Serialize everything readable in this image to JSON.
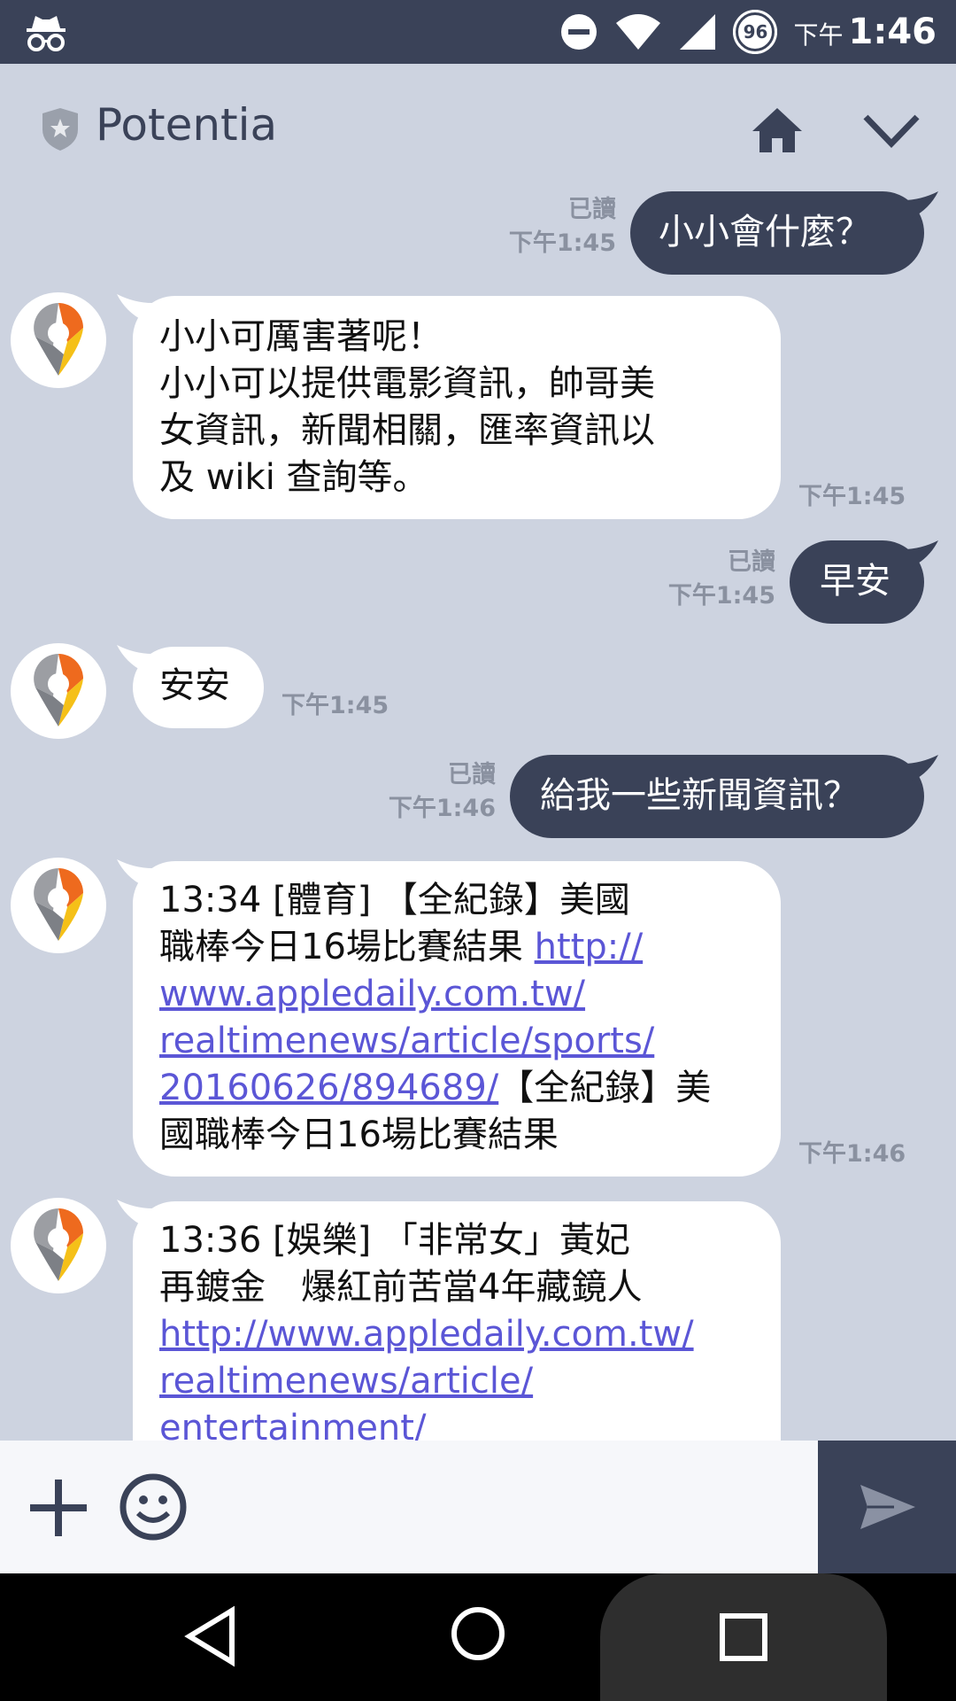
{
  "status_bar": {
    "battery_level": "96",
    "ampm": "下午",
    "time": "1:46"
  },
  "header": {
    "title": "Potentia"
  },
  "messages": [
    {
      "from": "me",
      "text": "小小會什麼？",
      "read": "已讀",
      "time": "下午1:45"
    },
    {
      "from": "bot",
      "lines": [
        "小小可厲害著呢！",
        "小小可以提供電影資訊，帥哥美",
        "女資訊，新聞相關，匯率資訊以",
        "及 wiki 查詢等。"
      ],
      "time": "下午1:45"
    },
    {
      "from": "me",
      "text": "早安",
      "read": "已讀",
      "time": "下午1:45"
    },
    {
      "from": "bot",
      "text": "安安",
      "time": "下午1:45"
    },
    {
      "from": "me",
      "text": "給我一些新聞資訊？",
      "read": "已讀",
      "time": "下午1:46"
    },
    {
      "from": "bot",
      "line1": "13:34  [體育] 【全紀錄】美國",
      "line2": "職棒今日16場比賽結果 ",
      "link_start": "http://",
      "link_lines": [
        "www.appledaily.com.tw/",
        "realtimenews/article/sports/"
      ],
      "link_end": "20160626/894689/",
      "tail": "【全紀錄】美",
      "line_last": "國職棒今日16場比賽結果",
      "time": "下午1:46"
    },
    {
      "from": "bot",
      "line1": "13:36  [娛樂] 「非常女」黃妃",
      "line2": "再鍍金　爆紅前苦當4年藏鏡人",
      "link_lines": [
        "http://www.appledaily.com.tw/",
        "realtimenews/article/",
        "entertainment/"
      ]
    }
  ],
  "input": {
    "placeholder": ""
  },
  "colors": {
    "background": "#cdd3e0",
    "bar": "#3a4258",
    "link": "#5b56d6"
  },
  "icons": [
    "incognito-icon",
    "dnd-icon",
    "wifi-icon",
    "signal-icon",
    "shield-icon",
    "home-icon",
    "chevron-down-icon",
    "plus-icon",
    "emoji-icon",
    "send-icon",
    "nav-back-icon",
    "nav-home-icon",
    "nav-recents-icon"
  ]
}
